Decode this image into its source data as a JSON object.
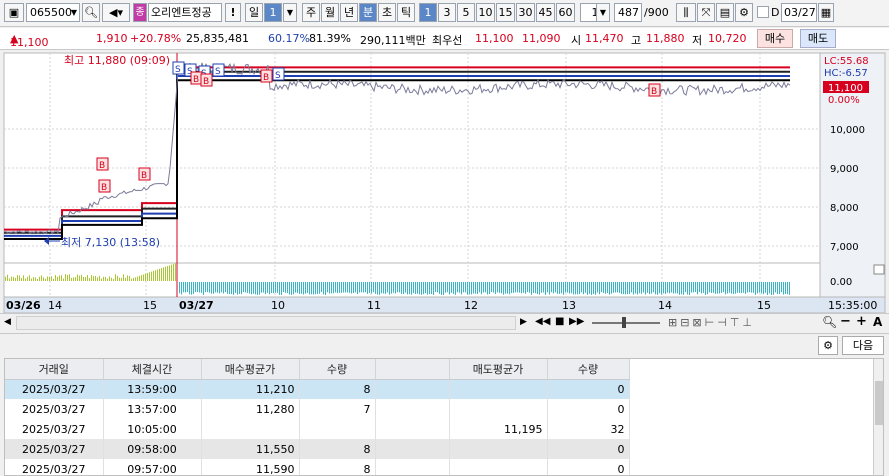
{
  "toolbar": {
    "code": "065500",
    "stock_name": "오리엔트정공",
    "period_buttons": [
      "일",
      "1",
      "주",
      "월",
      "년",
      "분",
      "초",
      "틱"
    ],
    "interval_buttons": [
      "1",
      "3",
      "5",
      "10",
      "15",
      "30",
      "45",
      "60"
    ],
    "interval_value": "1",
    "count": "487",
    "count_total": "/900",
    "checkbox_label": "D",
    "date": "03/27"
  },
  "info": {
    "price": "11,100",
    "change": "1,910",
    "change_pct": "+20.78%",
    "volume": "25,835,481",
    "ratio1": "60.17%",
    "ratio2": "81.39%",
    "amount": "290,111백만",
    "best_label": "최우선",
    "best_ask": "11,100",
    "best_bid": "11,090",
    "open_label": "시",
    "open": "11,470",
    "high_label": "고",
    "high": "11,880",
    "low_label": "저",
    "low": "10,720",
    "buy_btn": "매수",
    "sell_btn": "매도"
  },
  "chart": {
    "high_annot": "최고 11,880 (09:09)",
    "low_annot": "최저 7,130 (13:58)",
    "lc": "LC:55.68",
    "hc": "HC:-6.57",
    "price_tag": "11,100",
    "pct_tag": "0.00%",
    "y_ticks": [
      "10,000",
      "9,000",
      "8,000",
      "7,000"
    ],
    "vol_tick": "0.00",
    "x_labels": [
      "03/26",
      "14",
      "15",
      "03/27",
      "10",
      "11",
      "12",
      "13",
      "14",
      "15"
    ],
    "time_label": "15:35:00",
    "markers": [
      "S",
      "S",
      "S",
      "S",
      "S",
      "S",
      "B",
      "B",
      "B",
      "B",
      "B"
    ]
  },
  "colors": {
    "accent": "#5b87c6",
    "up": "#d7001e",
    "down": "#1f3fb0",
    "volume_up": "#a8c832",
    "volume_down": "#34b6c8"
  },
  "panel": {
    "next_btn": "다음",
    "headers": [
      "거래일",
      "체결시간",
      "매수평균가",
      "수량",
      "",
      "매도평균가",
      "수량"
    ],
    "rows": [
      [
        "2025/03/27",
        "13:59:00",
        "11,210",
        "8",
        "",
        "",
        "0"
      ],
      [
        "2025/03/27",
        "13:57:00",
        "11,280",
        "7",
        "",
        "",
        "0"
      ],
      [
        "2025/03/27",
        "10:05:00",
        "",
        "",
        "",
        "11,195",
        "32"
      ],
      [
        "2025/03/27",
        "09:58:00",
        "11,550",
        "8",
        "",
        "",
        "0"
      ],
      [
        "2025/03/27",
        "09:57:00",
        "11,590",
        "8",
        "",
        "",
        "0"
      ]
    ]
  }
}
